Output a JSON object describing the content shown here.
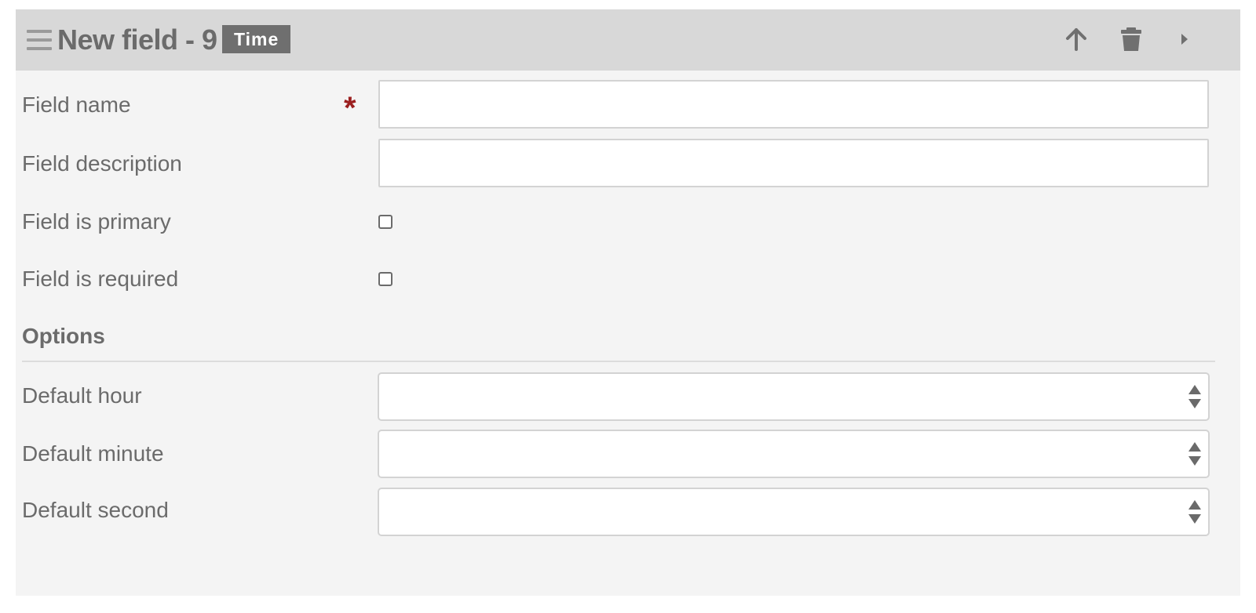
{
  "header": {
    "title": "New field - 9",
    "type_badge": "Time",
    "icons": [
      "drag-handle-icon",
      "arrow-up-icon",
      "trash-icon",
      "caret-right-icon"
    ]
  },
  "fields": {
    "field_name": {
      "label": "Field name",
      "required_mark": "*",
      "value": ""
    },
    "field_description": {
      "label": "Field description",
      "value": ""
    },
    "field_is_primary": {
      "label": "Field is primary",
      "checked": false
    },
    "field_is_required": {
      "label": "Field is required",
      "checked": false
    }
  },
  "options": {
    "title": "Options",
    "default_hour": {
      "label": "Default hour",
      "value": ""
    },
    "default_minute": {
      "label": "Default minute",
      "value": ""
    },
    "default_second": {
      "label": "Default second",
      "value": ""
    }
  },
  "colors": {
    "header_bg": "#d8d8d8",
    "panel_bg": "#f4f4f4",
    "badge_bg": "#6f6f6f",
    "required": "#9b1f1f",
    "text": "#6b6b6b"
  }
}
